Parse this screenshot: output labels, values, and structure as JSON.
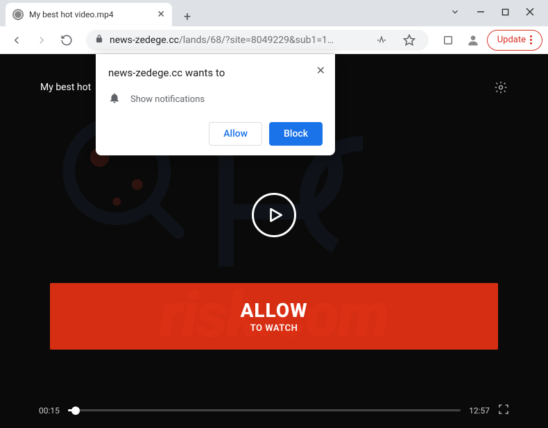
{
  "window": {
    "tab_title": "My best hot video.mp4"
  },
  "address": {
    "domain": "news-zedege.cc",
    "path": "/lands/68/?site=8049229&sub1=1…",
    "update_label": "Update"
  },
  "permission": {
    "title_prefix": "news-zedege.cc wants to",
    "notification_label": "Show notifications",
    "allow_label": "Allow",
    "block_label": "Block"
  },
  "page": {
    "video_title": "My best hot",
    "banner_big": "ALLOW",
    "banner_small": "TO WATCH",
    "time_current": "00:15",
    "time_total": "12:57"
  },
  "watermark": {
    "text": "risk.com"
  }
}
